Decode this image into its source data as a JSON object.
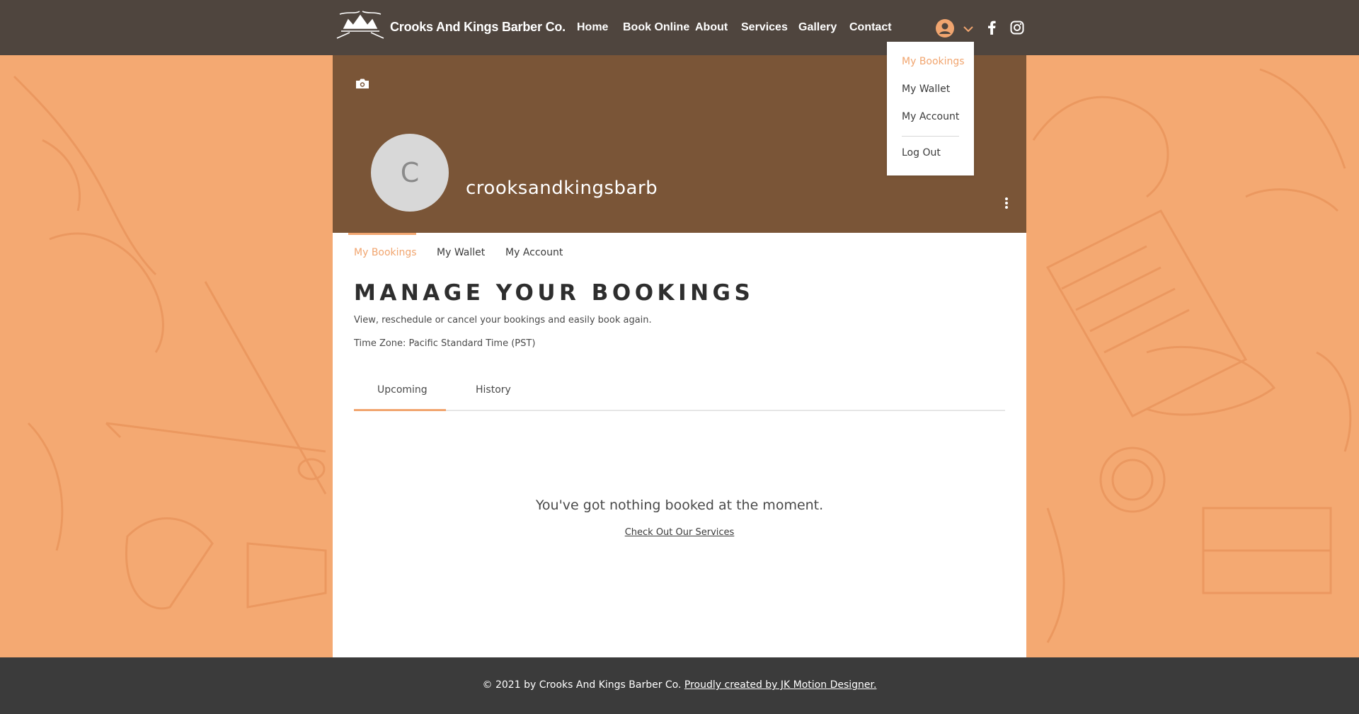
{
  "header": {
    "brand": "Crooks And Kings Barber Co.",
    "nav": [
      "Home",
      "Book Online",
      "About",
      "Services",
      "Gallery",
      "Contact"
    ]
  },
  "profile": {
    "avatar_letter": "C",
    "username": "crooksandkingsbarb",
    "tabs": [
      "My Bookings",
      "My Wallet",
      "My Account"
    ]
  },
  "bookings": {
    "title": "MANAGE YOUR BOOKINGS",
    "subtitle": "View, reschedule or cancel your bookings and easily book again.",
    "timezone": "Time Zone: Pacific Standard Time (PST)",
    "tabs": [
      "Upcoming",
      "History"
    ],
    "empty_message": "You've got nothing booked at the moment.",
    "empty_link": "Check Out Our Services"
  },
  "dropdown": {
    "items": [
      "My Bookings",
      "My Wallet",
      "My Account"
    ],
    "logout": "Log Out"
  },
  "footer": {
    "text": "© 2021 by Crooks And Kings Barber Co. ",
    "link": "Proudly created by JK Motion Designer."
  },
  "colors": {
    "accent": "#f1a56f",
    "header_bg": "#4f453e",
    "cover_bg": "#7a5537",
    "page_bg": "#f4a972",
    "footer_bg": "#3b3b3b"
  }
}
